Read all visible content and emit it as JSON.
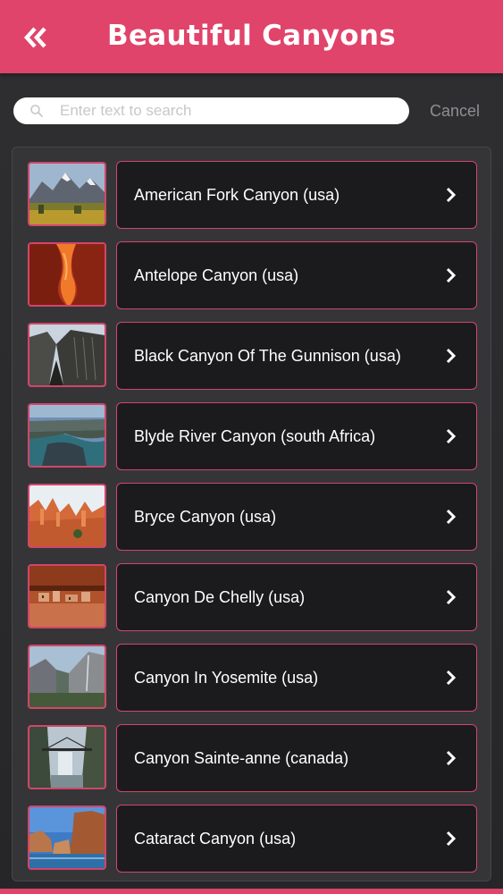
{
  "header": {
    "title": "Beautiful Canyons",
    "back_icon": "double-chevron-left-icon",
    "color": "#e0446a"
  },
  "search": {
    "placeholder": "Enter text to search",
    "value": "",
    "cancel_label": "Cancel"
  },
  "list": {
    "items": [
      {
        "label": "American Fork Canyon (usa)"
      },
      {
        "label": "Antelope Canyon (usa)"
      },
      {
        "label": "Black Canyon Of The Gunnison (usa)"
      },
      {
        "label": "Blyde River Canyon (south Africa)"
      },
      {
        "label": "Bryce Canyon (usa)"
      },
      {
        "label": "Canyon De Chelly (usa)"
      },
      {
        "label": "Canyon In Yosemite (usa)"
      },
      {
        "label": "Canyon Sainte-anne (canada)"
      },
      {
        "label": "Cataract Canyon (usa)"
      }
    ]
  },
  "colors": {
    "accent": "#e0446a",
    "item_background": "#1b1b1d",
    "panel_background": "#353537"
  }
}
